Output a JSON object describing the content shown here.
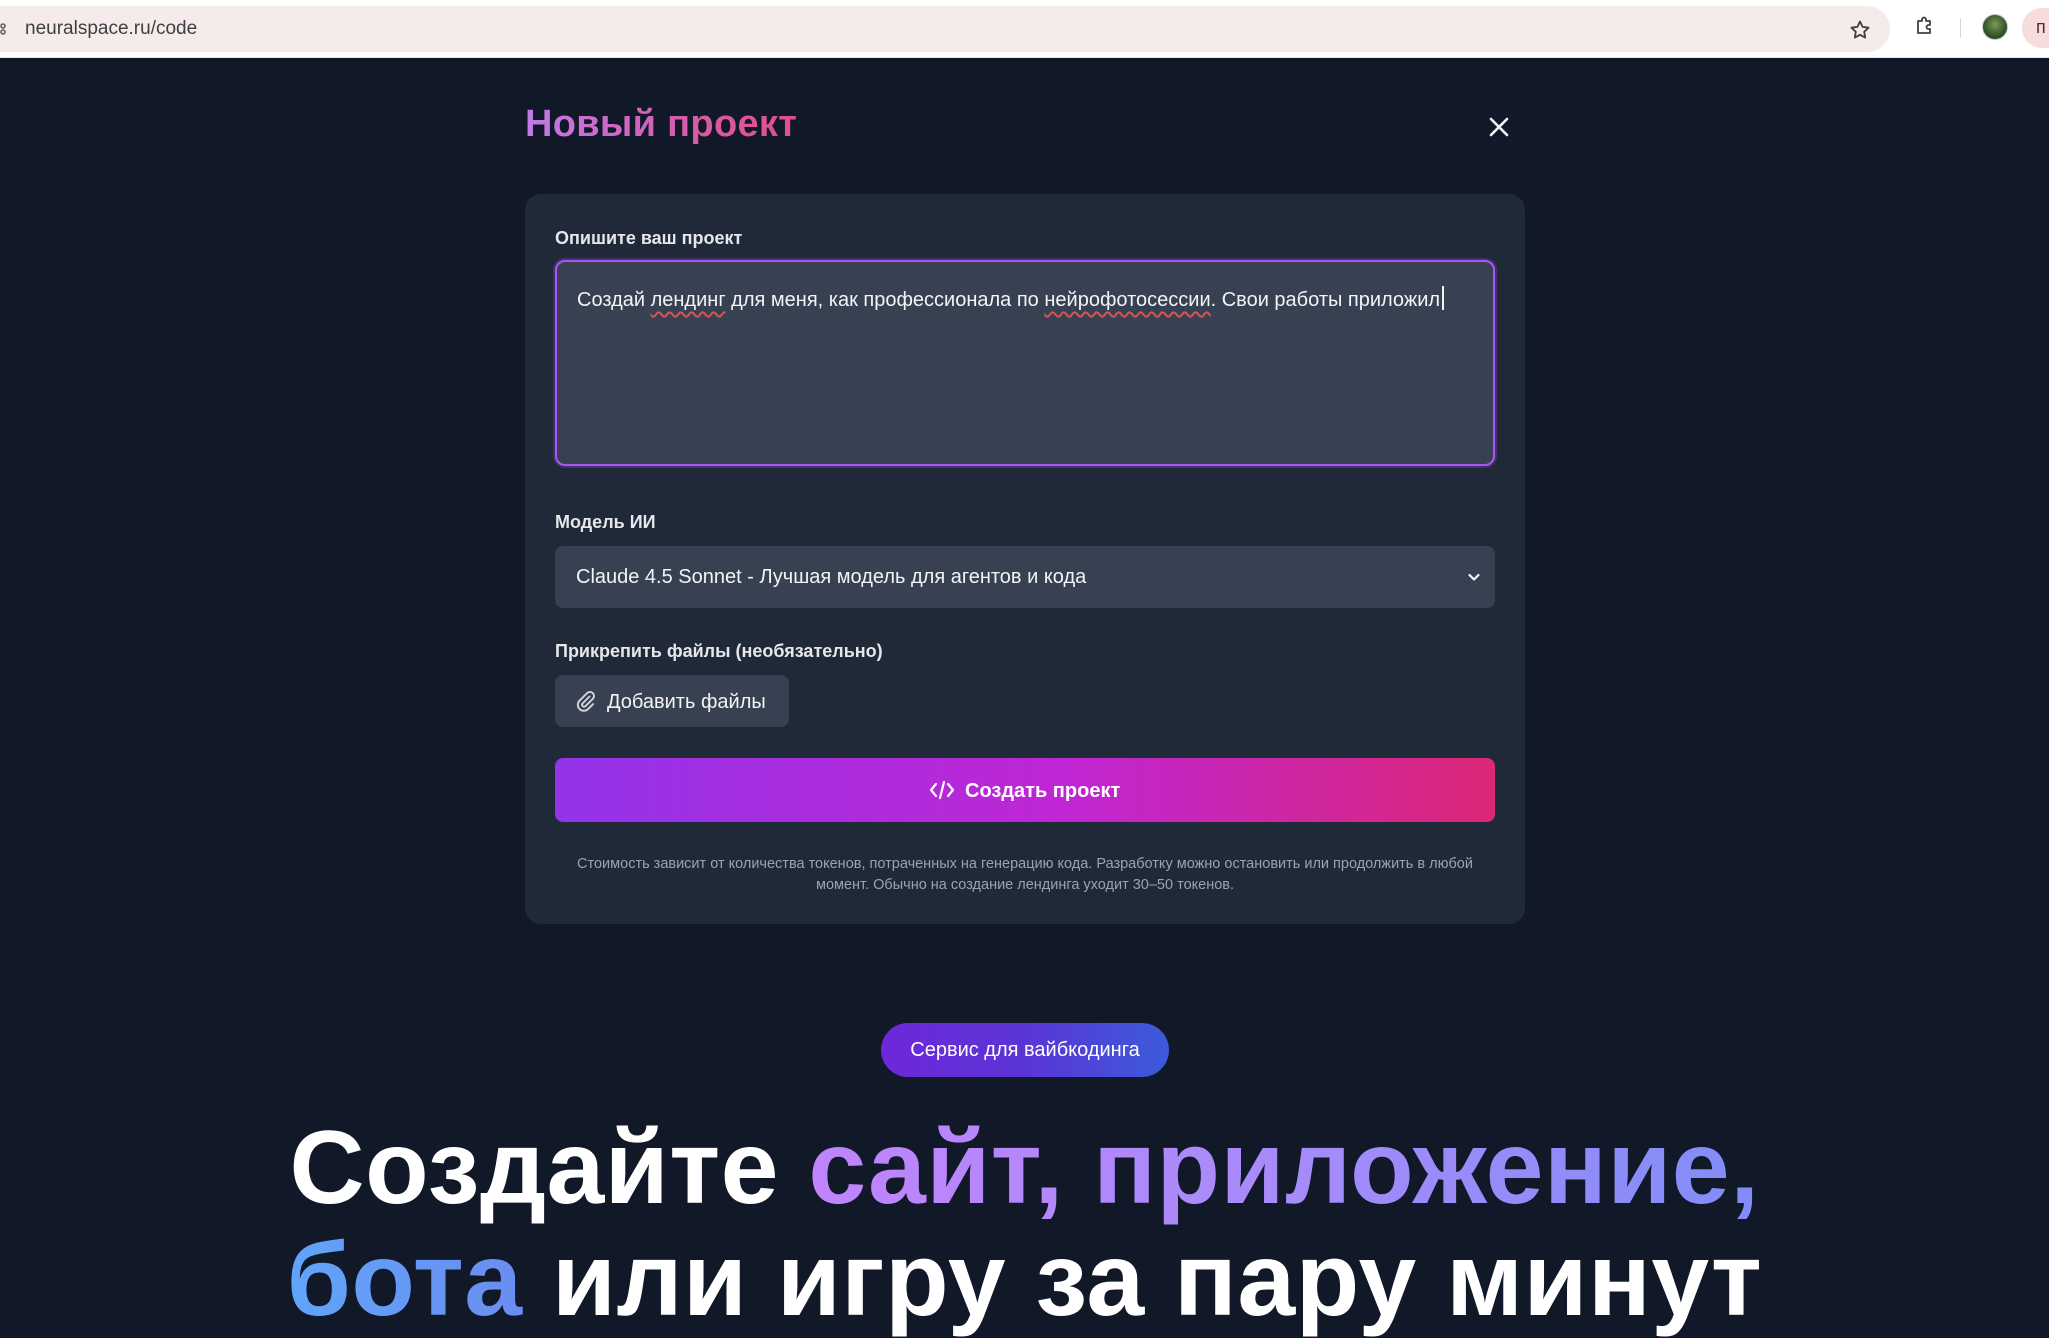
{
  "browser": {
    "url": "neuralspace.ru/code",
    "profile_initial": "п"
  },
  "modal": {
    "title": "Новый проект",
    "description_label": "Опишите ваш проект",
    "description_parts": [
      "Создай ",
      "лендинг",
      " для меня, как профессионала по ",
      "нейрофотосессии",
      ". Свои работы приложил"
    ],
    "model_label": "Модель ИИ",
    "model_selected": "Claude 4.5 Sonnet - Лучшая модель для агентов и кода",
    "attach_label": "Прикрепить файлы (необязательно)",
    "attach_button": "Добавить файлы",
    "create_button": "Создать проект",
    "note": "Стоимость зависит от количества токенов, потраченных на генерацию кода. Разработку можно остановить или продолжить в любой момент. Обычно на создание лендинга уходит 30–50 токенов."
  },
  "hero": {
    "badge": "Сервис для вайбкодинга",
    "line1_plain": "Создайте ",
    "line1_accent": "сайт, приложение,",
    "line2_accent": "бота",
    "line2_plain": " или игру за пару минут"
  },
  "colors": {
    "page_bg": "#111827",
    "card_bg": "#1f2937",
    "field_bg": "#374151",
    "focus_ring": "#a855f7",
    "button_gradient_start": "#9333ea",
    "button_gradient_end": "#db2777"
  },
  "icons": {
    "close": "close-icon",
    "chevron": "chevron-down-icon",
    "attach": "paperclip-icon",
    "code": "code-icon",
    "bookmark": "star-icon",
    "extensions": "puzzle-icon"
  }
}
